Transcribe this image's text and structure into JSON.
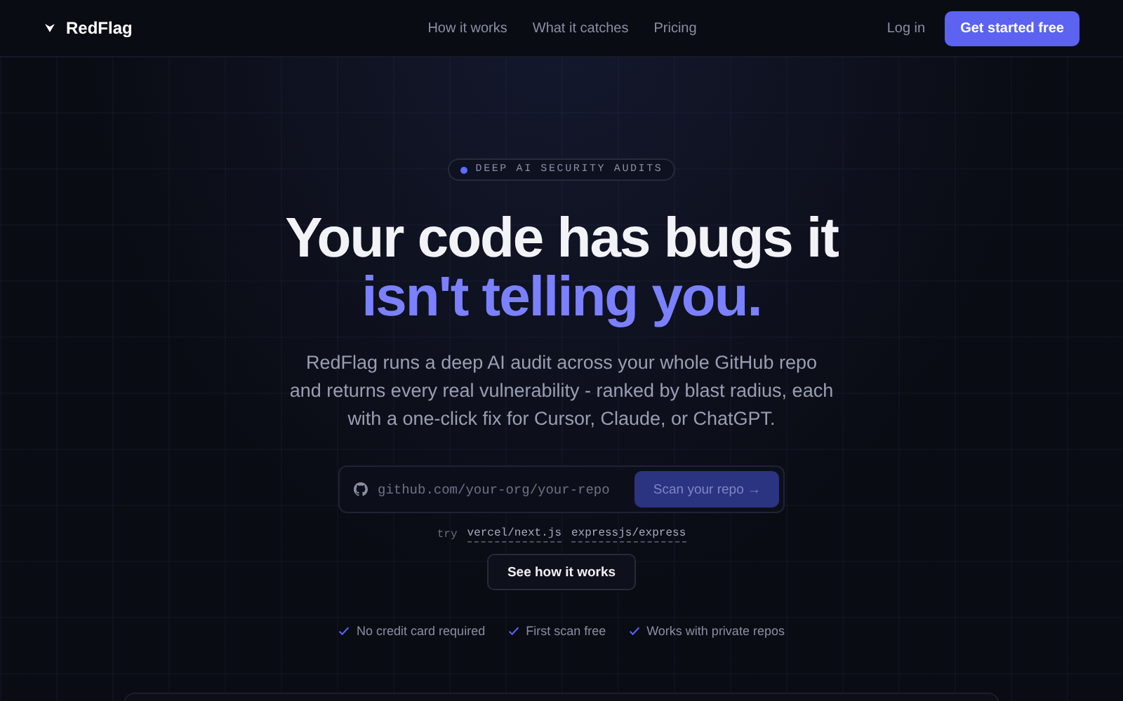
{
  "nav": {
    "brand": "RedFlag",
    "links": [
      "How it works",
      "What it catches",
      "Pricing"
    ],
    "login": "Log in",
    "cta": "Get started free"
  },
  "badge": "DEEP AI SECURITY AUDITS",
  "headline": {
    "line1": "Your code has bugs it",
    "line2": "isn't telling you."
  },
  "description": "RedFlag runs a deep AI audit across your whole GitHub repo and returns every real vulnerability - ranked by blast radius, each with a one-click fix for Cursor, Claude, or ChatGPT.",
  "repo_field": {
    "placeholder": "github.com/your-org/your-repo"
  },
  "scan_button": "Scan your repo →",
  "try": {
    "label": "try",
    "examples": [
      "vercel/next.js",
      "expressjs/express"
    ]
  },
  "secondary_button": "See how it works",
  "perks": [
    "No credit card required",
    "First scan free",
    "Works with private repos"
  ]
}
